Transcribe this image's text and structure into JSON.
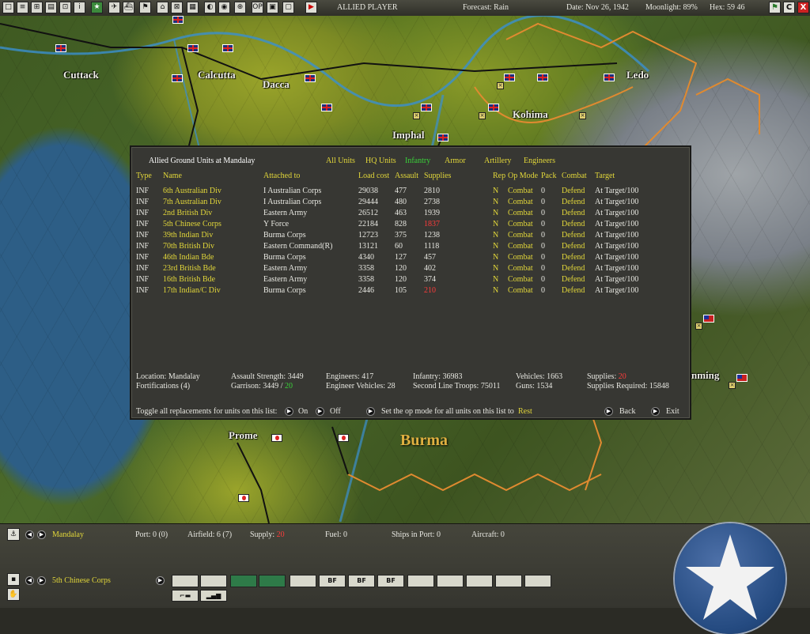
{
  "topbar": {
    "player": "ALLIED PLAYER",
    "forecast": "Forecast: Rain",
    "date": "Date: Nov 26, 1942",
    "moonlight": "Moonlight: 89%",
    "hex": "Hex: 59 46",
    "right_buttons": [
      "C",
      "X"
    ]
  },
  "map": {
    "cities": [
      "Cuttack",
      "Calcutta",
      "Dacca",
      "Imphal",
      "Kohima",
      "Ledo",
      "Prome",
      "nming"
    ],
    "region": "Burma"
  },
  "dialog": {
    "title": "Allied Ground Units at Mandalay",
    "filters": [
      "All Units",
      "HQ Units",
      "Infantry",
      "Armor",
      "Artillery",
      "Engineers"
    ],
    "active_filter": "Infantry",
    "columns": [
      "Type",
      "Name",
      "Attached to",
      "Load cost",
      "Assault",
      "Supplies",
      "Rep",
      "Op Mode",
      "Pack",
      "Combat",
      "Target"
    ],
    "rows": [
      {
        "type": "INF",
        "name": "6th Australian Div",
        "attached": "I Australian Corps",
        "load": "29038",
        "assault": "477",
        "supplies": "2810",
        "low": false,
        "rep": "N",
        "op": "Combat",
        "pack": "0",
        "combat": "Defend",
        "target": "At Target/100"
      },
      {
        "type": "INF",
        "name": "7th Australian Div",
        "attached": "I Australian Corps",
        "load": "29444",
        "assault": "480",
        "supplies": "2738",
        "low": false,
        "rep": "N",
        "op": "Combat",
        "pack": "0",
        "combat": "Defend",
        "target": "At Target/100"
      },
      {
        "type": "INF",
        "name": "2nd British Div",
        "attached": "Eastern Army",
        "load": "26512",
        "assault": "463",
        "supplies": "1939",
        "low": false,
        "rep": "N",
        "op": "Combat",
        "pack": "0",
        "combat": "Defend",
        "target": "At Target/100"
      },
      {
        "type": "INF",
        "name": "5th Chinese Corps",
        "attached": "Y Force",
        "load": "22184",
        "assault": "828",
        "supplies": "1837",
        "low": true,
        "rep": "N",
        "op": "Combat",
        "pack": "0",
        "combat": "Defend",
        "target": "At Target/100"
      },
      {
        "type": "INF",
        "name": "39th Indian Div",
        "attached": "Burma Corps",
        "load": "12723",
        "assault": "375",
        "supplies": "1238",
        "low": false,
        "rep": "N",
        "op": "Combat",
        "pack": "0",
        "combat": "Defend",
        "target": "At Target/100"
      },
      {
        "type": "INF",
        "name": "70th British Div",
        "attached": "Eastern Command(R)",
        "load": "13121",
        "assault": "60",
        "supplies": "1118",
        "low": false,
        "rep": "N",
        "op": "Combat",
        "pack": "0",
        "combat": "Defend",
        "target": "At Target/100"
      },
      {
        "type": "INF",
        "name": "46th Indian Bde",
        "attached": "Burma Corps",
        "load": "4340",
        "assault": "127",
        "supplies": "457",
        "low": false,
        "rep": "N",
        "op": "Combat",
        "pack": "0",
        "combat": "Defend",
        "target": "At Target/100"
      },
      {
        "type": "INF",
        "name": "23rd British Bde",
        "attached": "Eastern Army",
        "load": "3358",
        "assault": "120",
        "supplies": "402",
        "low": false,
        "rep": "N",
        "op": "Combat",
        "pack": "0",
        "combat": "Defend",
        "target": "At Target/100"
      },
      {
        "type": "INF",
        "name": "16th British Bde",
        "attached": "Eastern Army",
        "load": "3358",
        "assault": "120",
        "supplies": "374",
        "low": false,
        "rep": "N",
        "op": "Combat",
        "pack": "0",
        "combat": "Defend",
        "target": "At Target/100"
      },
      {
        "type": "INF",
        "name": "17th Indian/C Div",
        "attached": "Burma Corps",
        "load": "2446",
        "assault": "105",
        "supplies": "210",
        "low": true,
        "rep": "N",
        "op": "Combat",
        "pack": "0",
        "combat": "Defend",
        "target": "At Target/100"
      }
    ],
    "summary": {
      "location": "Location: Mandalay",
      "fortifications": "Fortifications (4)",
      "assault_strength": "Assault Strength: 3449",
      "garrison_label": "Garrison: 3449 / ",
      "garrison_value": "20",
      "engineers": "Engineers: 417",
      "engineer_vehicles": "Engineer Vehicles: 28",
      "infantry": "Infantry: 36983",
      "second_line": "Second Line Troops: 75011",
      "vehicles": "Vehicles: 1663",
      "guns": "Guns: 1534",
      "supplies_label": "Supplies: ",
      "supplies_value": "20",
      "supplies_required": "Supplies Required: 15848"
    },
    "footer": {
      "toggle_label": "Toggle all replacements for units on this list:",
      "on": "On",
      "off": "Off",
      "opmode_label": "Set the op mode for all units on this list to",
      "opmode_value": "Rest",
      "back": "Back",
      "exit": "Exit"
    }
  },
  "bottom": {
    "base_name": "Mandalay",
    "port": "Port: 0 (0)",
    "airfield": "Airfield: 6 (7)",
    "supply_label": "Supply: ",
    "supply_value": "20",
    "fuel": "Fuel: 0",
    "ships": "Ships in Port: 0",
    "aircraft": "Aircraft: 0",
    "unit_name": "5th Chinese Corps",
    "unit_buttons": [
      "",
      "",
      "",
      "",
      "",
      "BF",
      "BF",
      "BF",
      "",
      "",
      "",
      "",
      ""
    ]
  }
}
